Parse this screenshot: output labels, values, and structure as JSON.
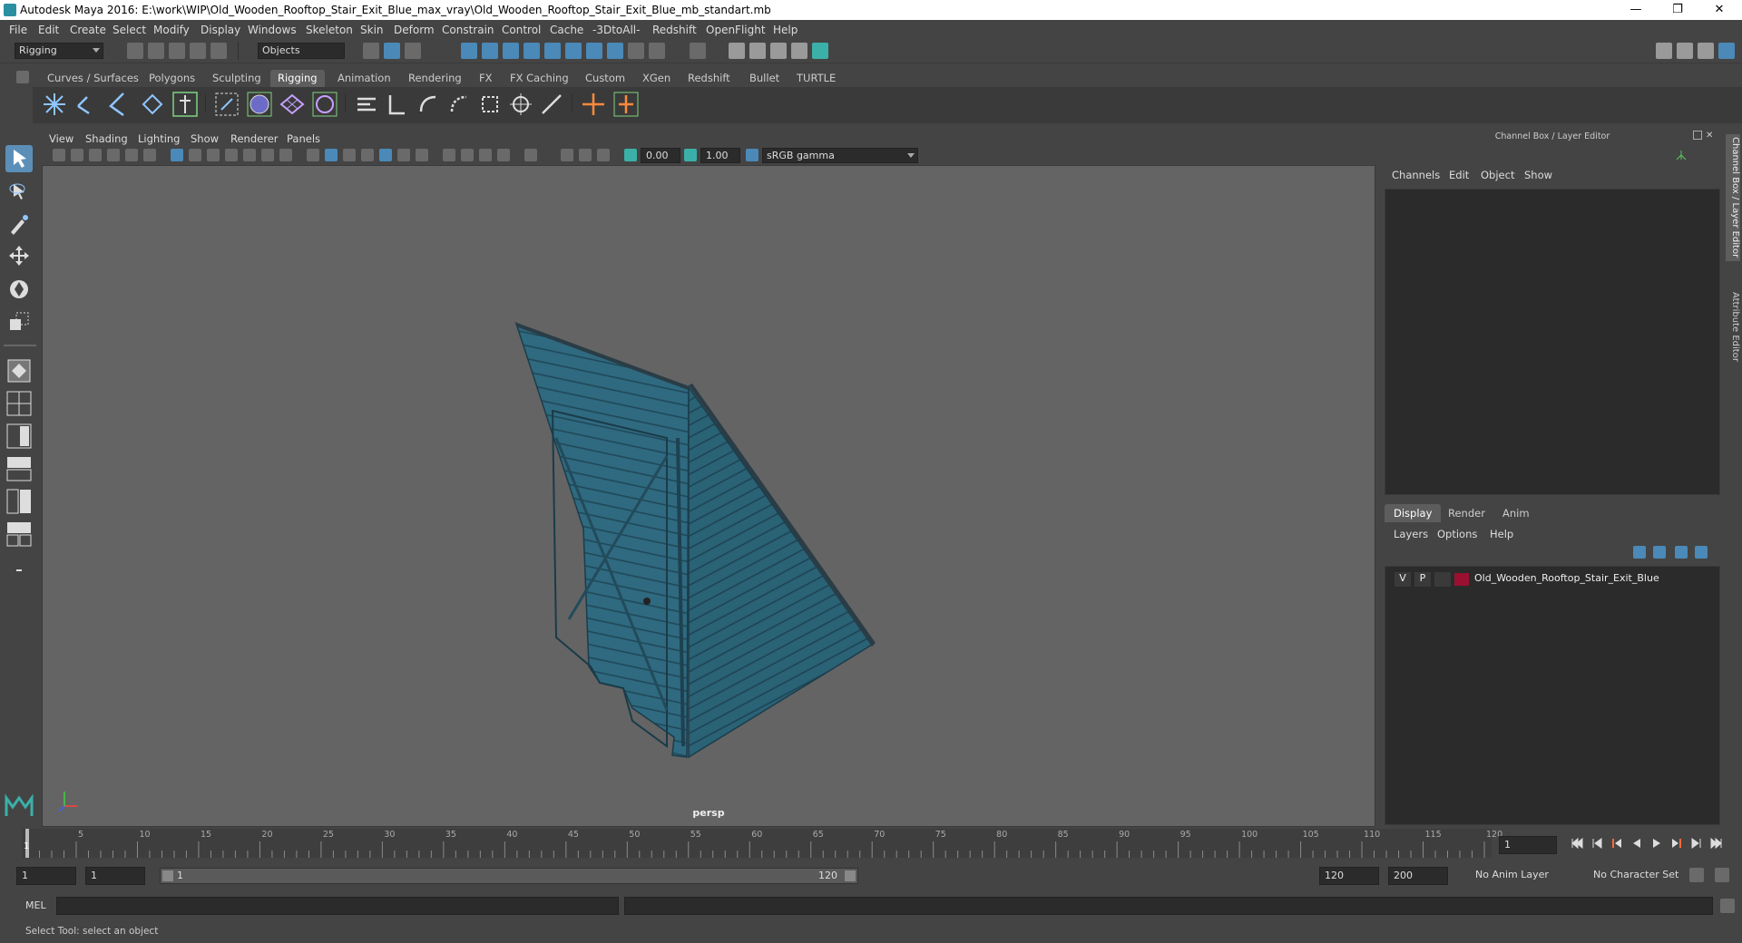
{
  "titlebar": {
    "title": "Autodesk Maya 2016: E:\\work\\WIP\\Old_Wooden_Rooftop_Stair_Exit_Blue_max_vray\\Old_Wooden_Rooftop_Stair_Exit_Blue_mb_standart.mb",
    "minimize": "—",
    "restore": "❐",
    "close": "✕"
  },
  "menubar": [
    "File",
    "Edit",
    "Create",
    "Select",
    "Modify",
    "Display",
    "Windows",
    "Skeleton",
    "Skin",
    "Deform",
    "Constrain",
    "Control",
    "Cache",
    "-3DtoAll-",
    "Redshift",
    "OpenFlight",
    "Help"
  ],
  "statusline": {
    "menuset": "Rigging",
    "selmode": "Objects"
  },
  "shelf_tabs": [
    "Curves / Surfaces",
    "Polygons",
    "Sculpting",
    "Rigging",
    "Animation",
    "Rendering",
    "FX",
    "FX Caching",
    "Custom",
    "XGen",
    "Redshift",
    "Bullet",
    "TURTLE"
  ],
  "active_shelf_tab": "Rigging",
  "panel_menu": [
    "View",
    "Shading",
    "Lighting",
    "Show",
    "Renderer",
    "Panels"
  ],
  "panel_toolbar": {
    "exposure": "0.00",
    "gamma": "1.00",
    "colorspace": "sRGB gamma"
  },
  "viewport": {
    "camera": "persp"
  },
  "channel_box": {
    "title": "Channel Box / Layer Editor",
    "menu": [
      "Channels",
      "Edit",
      "Object",
      "Show"
    ]
  },
  "layer_editor": {
    "tabs": [
      "Display",
      "Render",
      "Anim"
    ],
    "active_tab": "Display",
    "menu": [
      "Layers",
      "Options",
      "Help"
    ],
    "layer": {
      "visible": "V",
      "playback": "P",
      "name": "Old_Wooden_Rooftop_Stair_Exit_Blue",
      "color": "#9b1030"
    }
  },
  "side_tabs": [
    "Channel Box / Layer Editor",
    "Attribute Editor"
  ],
  "timeline": {
    "ticks": [
      "5",
      "10",
      "15",
      "20",
      "25",
      "30",
      "35",
      "40",
      "45",
      "50",
      "55",
      "60",
      "65",
      "70",
      "75",
      "80",
      "85",
      "90",
      "95",
      "100",
      "105",
      "110",
      "115",
      "120"
    ],
    "current_frame_field": "1",
    "playhead_label": "1"
  },
  "range": {
    "start": "1",
    "playback_start": "1",
    "slider_start": "1",
    "slider_end": "120",
    "playback_end": "120",
    "end": "200",
    "anim_layer": "No Anim Layer",
    "char_set": "No Character Set"
  },
  "command": {
    "lang": "MEL"
  },
  "help": {
    "text": "Select Tool: select an object"
  }
}
